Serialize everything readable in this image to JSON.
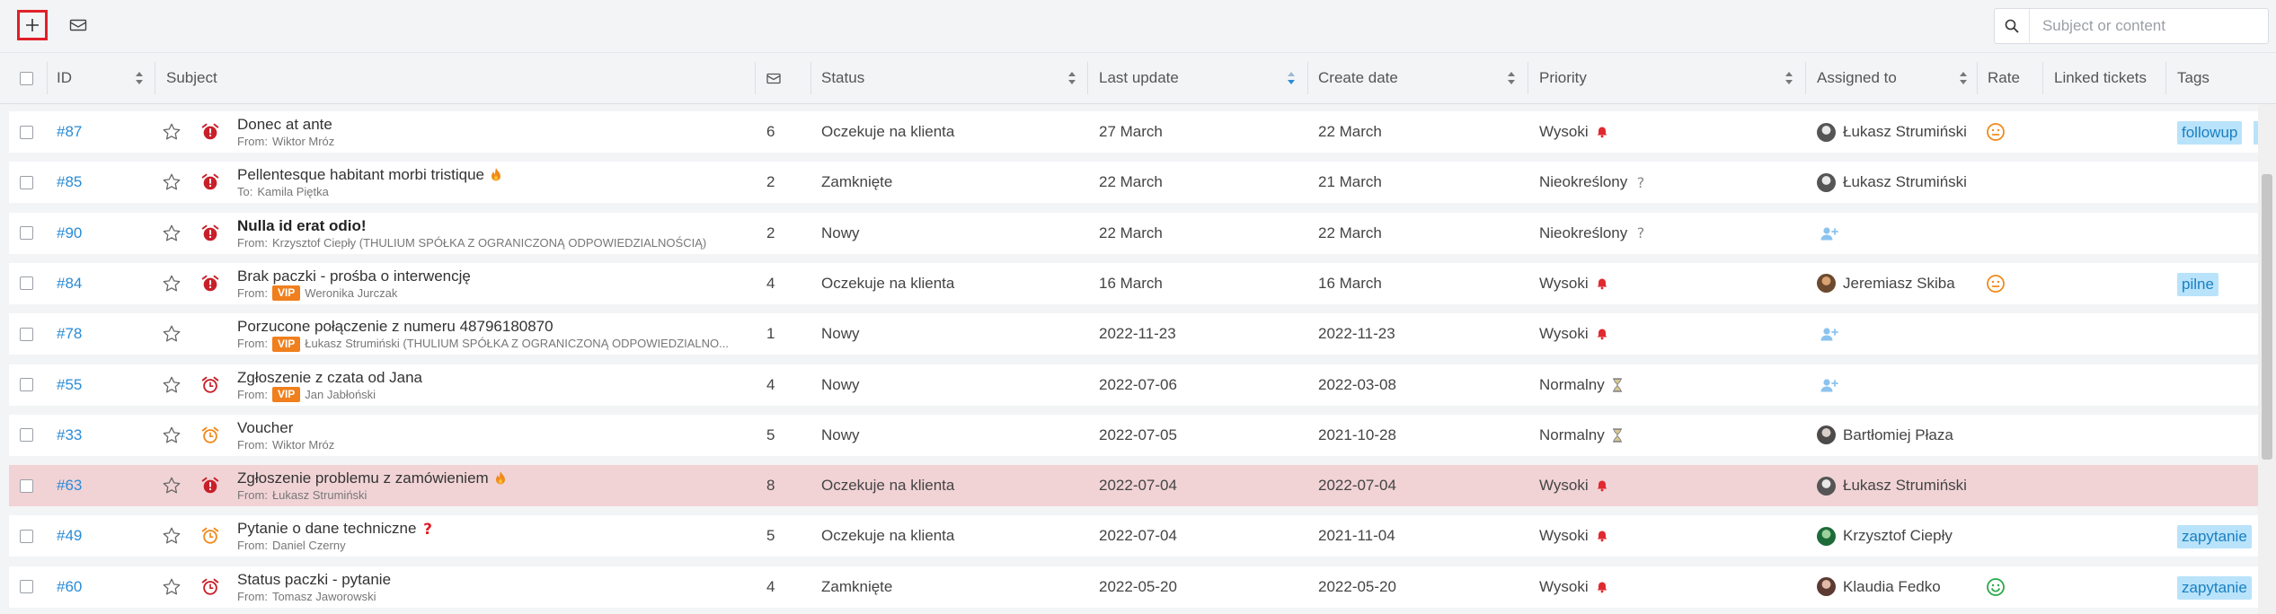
{
  "toolbar": {
    "search_placeholder": "Subject or content"
  },
  "columns": {
    "id": "ID",
    "subject": "Subject",
    "status": "Status",
    "last_update": "Last update",
    "create_date": "Create date",
    "priority": "Priority",
    "assigned": "Assigned to",
    "rate": "Rate",
    "linked": "Linked tickets",
    "tags": "Tags"
  },
  "colors": {
    "link": "#2a8bd6",
    "vip": "#f07f1d",
    "tag_bg": "#b9e3fb",
    "tag_text": "#1a7fc0",
    "highlight_row": "#f1d3d6",
    "alarm_red": "#c8202a",
    "alarm_orange": "#f08a1d"
  },
  "tickets": [
    {
      "id": "#87",
      "subject": "Donec at ante",
      "bold": false,
      "from_label": "From:",
      "from": "Wiktor Mróz",
      "vip": false,
      "subject_icon": "",
      "alarm": "alarm-red",
      "messages": "6",
      "status": "Oczekuje na klienta",
      "last_update": "27 March",
      "create_date": "22 March",
      "priority": "Wysoki",
      "priority_icon": "bell-icon",
      "assigned": "Łukasz Strumiński",
      "avatar": "avatar-lukasz",
      "rate": "neutral-face-icon",
      "tag": "followup",
      "tag_more": true,
      "highlight": false
    },
    {
      "id": "#85",
      "subject": "Pellentesque habitant morbi tristique",
      "bold": false,
      "from_label": "To:",
      "from": "Kamila Piętka",
      "vip": false,
      "subject_icon": "fire-icon",
      "alarm": "alarm-red",
      "messages": "2",
      "status": "Zamknięte",
      "last_update": "22 March",
      "create_date": "21 March",
      "priority": "Nieokreślony",
      "priority_icon": "question-icon",
      "assigned": "Łukasz Strumiński",
      "avatar": "avatar-lukasz",
      "rate": "",
      "tag": "",
      "tag_more": false,
      "highlight": false
    },
    {
      "id": "#90",
      "subject": "Nulla id erat odio!",
      "bold": true,
      "from_label": "From:",
      "from": "Krzysztof Ciepły (THULIUM SPÓŁKA Z OGRANICZONĄ ODPOWIEDZIALNOŚCIĄ)",
      "vip": false,
      "subject_icon": "",
      "alarm": "alarm-red",
      "messages": "2",
      "status": "Nowy",
      "last_update": "22 March",
      "create_date": "22 March",
      "priority": "Nieokreślony",
      "priority_icon": "question-icon",
      "assigned": "",
      "avatar": "assign-user-icon",
      "rate": "",
      "tag": "",
      "tag_more": false,
      "highlight": false
    },
    {
      "id": "#84",
      "subject": "Brak paczki - prośba o interwencję",
      "bold": false,
      "from_label": "From:",
      "from": "Weronika Jurczak",
      "vip": true,
      "subject_icon": "",
      "alarm": "alarm-red",
      "messages": "4",
      "status": "Oczekuje na klienta",
      "last_update": "16 March",
      "create_date": "16 March",
      "priority": "Wysoki",
      "priority_icon": "bell-icon",
      "assigned": "Jeremiasz Skiba",
      "avatar": "avatar-jeremiasz",
      "rate": "neutral-face-icon",
      "tag": "pilne",
      "tag_more": false,
      "highlight": false
    },
    {
      "id": "#78",
      "subject": "Porzucone połączenie z numeru 48796180870",
      "bold": false,
      "from_label": "From:",
      "from": "Łukasz Strumiński (THULIUM SPÓŁKA Z OGRANICZONĄ ODPOWIEDZIALNO...",
      "vip": true,
      "subject_icon": "",
      "alarm": "",
      "messages": "1",
      "status": "Nowy",
      "last_update": "2022-11-23",
      "create_date": "2022-11-23",
      "priority": "Wysoki",
      "priority_icon": "bell-icon",
      "assigned": "",
      "avatar": "assign-user-icon",
      "rate": "",
      "tag": "",
      "tag_more": false,
      "highlight": false
    },
    {
      "id": "#55",
      "subject": "Zgłoszenie z czata od Jana",
      "bold": false,
      "from_label": "From:",
      "from": "Jan Jabłoński",
      "vip": true,
      "subject_icon": "",
      "alarm": "alarm-red-outline",
      "messages": "4",
      "status": "Nowy",
      "last_update": "2022-07-06",
      "create_date": "2022-03-08",
      "priority": "Normalny",
      "priority_icon": "hourglass-icon",
      "assigned": "",
      "avatar": "assign-user-icon",
      "rate": "",
      "tag": "",
      "tag_more": false,
      "highlight": false
    },
    {
      "id": "#33",
      "subject": "Voucher",
      "bold": false,
      "from_label": "From:",
      "from": "Wiktor Mróz",
      "vip": false,
      "subject_icon": "",
      "alarm": "alarm-orange",
      "messages": "5",
      "status": "Nowy",
      "last_update": "2022-07-05",
      "create_date": "2021-10-28",
      "priority": "Normalny",
      "priority_icon": "hourglass-icon",
      "assigned": "Bartłomiej Płaza",
      "avatar": "avatar-bartlomiej",
      "rate": "",
      "tag": "",
      "tag_more": false,
      "highlight": false
    },
    {
      "id": "#63",
      "subject": "Zgłoszenie problemu z zamówieniem",
      "bold": false,
      "from_label": "From:",
      "from": "Łukasz Strumiński",
      "vip": false,
      "subject_icon": "fire-icon",
      "alarm": "alarm-red",
      "messages": "8",
      "status": "Oczekuje na klienta",
      "last_update": "2022-07-04",
      "create_date": "2022-07-04",
      "priority": "Wysoki",
      "priority_icon": "bell-icon",
      "assigned": "Łukasz Strumiński",
      "avatar": "avatar-lukasz",
      "rate": "",
      "tag": "",
      "tag_more": false,
      "highlight": true
    },
    {
      "id": "#49",
      "subject": "Pytanie o dane techniczne",
      "bold": false,
      "from_label": "From:",
      "from": "Daniel Czerny",
      "vip": false,
      "subject_icon": "question-red-icon",
      "alarm": "alarm-orange",
      "messages": "5",
      "status": "Oczekuje na klienta",
      "last_update": "2022-07-04",
      "create_date": "2021-11-04",
      "priority": "Wysoki",
      "priority_icon": "bell-icon",
      "assigned": "Krzysztof Ciepły",
      "avatar": "avatar-krzysztof",
      "rate": "",
      "tag": "zapytanie",
      "tag_more": false,
      "highlight": false
    },
    {
      "id": "#60",
      "subject": "Status paczki - pytanie",
      "bold": false,
      "from_label": "From:",
      "from": "Tomasz Jaworowski",
      "vip": false,
      "subject_icon": "",
      "alarm": "alarm-red-outline",
      "messages": "4",
      "status": "Zamknięte",
      "last_update": "2022-05-20",
      "create_date": "2022-05-20",
      "priority": "Wysoki",
      "priority_icon": "bell-icon",
      "assigned": "Klaudia Fedko",
      "avatar": "avatar-klaudia",
      "rate": "happy-face-icon",
      "tag": "zapytanie",
      "tag_more": false,
      "highlight": false
    }
  ]
}
